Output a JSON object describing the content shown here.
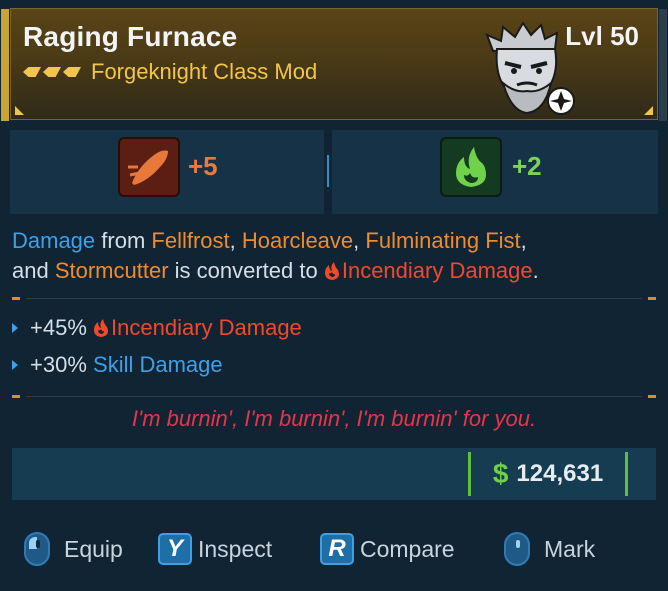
{
  "item": {
    "name": "Raging Furnace",
    "type": "Forgeknight Class Mod",
    "level": "Lvl 50",
    "rarity_color": "#f2c64a"
  },
  "skills": [
    {
      "icon": "fire-rocket-icon",
      "value": "+5",
      "color": "#e87a3c"
    },
    {
      "icon": "green-flame-icon",
      "value": "+2",
      "color": "#7ad25a"
    }
  ],
  "description": {
    "damage": "Damage",
    "from": " from ",
    "skill1": "Fellfrost",
    "comma1": ", ",
    "skill2": "Hoarcleave",
    "comma2": ", ",
    "skill3": "Fulminating Fist",
    "comma3": ",",
    "and": "and ",
    "skill4": "Stormcutter",
    "converted": " is converted to ",
    "element": "Incendiary Damage",
    "period": "."
  },
  "stats": [
    {
      "value": "+45%",
      "label": "Incendiary Damage"
    },
    {
      "value": "+30%",
      "label": "Skill Damage"
    }
  ],
  "flavor_text": "I'm burnin', I'm burnin', I'm burnin' for you.",
  "price": {
    "currency_icon": "$",
    "amount": "124,631"
  },
  "actions": [
    {
      "icon": "mouse-left-icon",
      "label": "Equip"
    },
    {
      "icon": "y-key-icon",
      "key": "Y",
      "label": "Inspect"
    },
    {
      "icon": "r-key-icon",
      "key": "R",
      "label": "Compare"
    },
    {
      "icon": "mouse-middle-icon",
      "label": "Mark"
    }
  ]
}
